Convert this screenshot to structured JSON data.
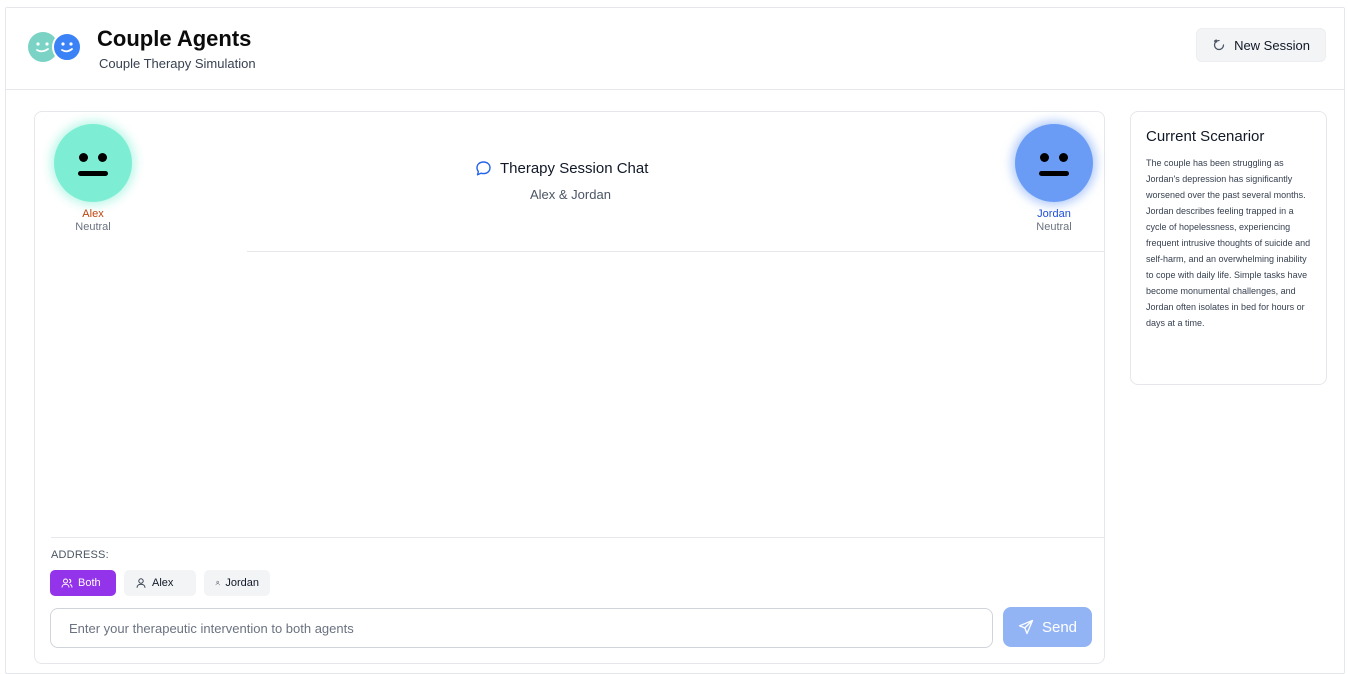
{
  "header": {
    "title": "Couple Agents",
    "subtitle": "Couple Therapy Simulation",
    "new_session_label": "New Session"
  },
  "agents": {
    "alex": {
      "name": "Alex",
      "mood": "Neutral",
      "color": "#7deed4",
      "name_color": "#c2410c"
    },
    "jordan": {
      "name": "Jordan",
      "mood": "Neutral",
      "color": "#6b9cf5",
      "name_color": "#1d4ed8"
    }
  },
  "chat": {
    "title": "Therapy Session Chat",
    "participants": "Alex & Jordan",
    "messages": []
  },
  "address": {
    "label": "ADDRESS:",
    "options": [
      {
        "label": "Both",
        "active": true,
        "icon": "users-icon"
      },
      {
        "label": "Alex",
        "active": false,
        "icon": "user-icon"
      },
      {
        "label": "Jordan",
        "active": false,
        "icon": "user-icon"
      }
    ]
  },
  "input": {
    "value": "",
    "placeholder": "Enter your therapeutic intervention to both agents",
    "send_label": "Send"
  },
  "scenario": {
    "title": "Current Scenarior",
    "text": "The couple has been struggling as Jordan's depression has significantly worsened over the past several months. Jordan describes feeling trapped in a cycle of hopelessness, experiencing frequent intrusive thoughts of suicide and self-harm, and an overwhelming inability to cope with daily life. Simple tasks have become monumental challenges, and Jordan often isolates in bed for hours or days at a time."
  },
  "colors": {
    "accent_purple": "#9333ea",
    "send_button": "#93b4f4",
    "chat_icon": "#2563eb"
  }
}
